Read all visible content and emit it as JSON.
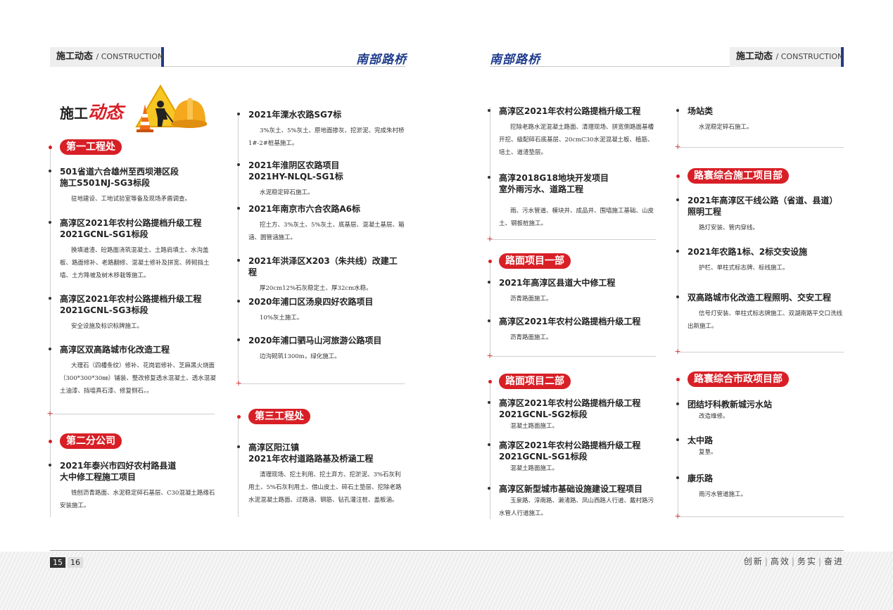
{
  "header": {
    "tab_cn": "施工动态",
    "tab_en": "/ CONSTRUCTION",
    "brand": "南部路桥"
  },
  "main_title": {
    "a": "施工",
    "b": "动态"
  },
  "left": {
    "col1": {
      "s1": {
        "badge": "第一工程处",
        "items": [
          {
            "title": "501省道六合雄州至西坝港区段\n施工S501NJ-SG3标段",
            "desc": "驻地建设、工地试验室等备及现场矛盾调查。"
          },
          {
            "title": "高淳区2021年农村公路提档升级工程\n2021GCNL-SG1标段",
            "desc": "换填道渣、砼路面浇筑混凝土、土路肩填土、水沟盖板、路面修补、老路翻修、混凝土修补及拼宽、砖砌挡土墙、土方降坡及树木移栽等施工。"
          },
          {
            "title": "高淳区2021年农村公路提档升级工程\n2021GCNL-SG3标段",
            "desc": "安全设施及标识标牌施工。"
          },
          {
            "title": "高淳区双高路城市化改造工程",
            "desc": "大理石（四槽条纹）修补、花岗岩修补、芝麻黑火烧面（300*300*30㎜）铺装、整改修复透水混凝土、透水混凝土油漆、挡墙真石漆、修复侧石。。"
          }
        ]
      },
      "s2": {
        "badge": "第二分公司",
        "items": [
          {
            "title": "2021年泰兴市四好农村路县道\n大中修工程施工项目",
            "desc": "铣刨沥青路面、水泥稳定碎石基层、C30混凝土路缘石安装施工。"
          }
        ]
      }
    },
    "col2": {
      "items": [
        {
          "title": "2021年溧水农路SG7标",
          "desc": "3%灰土、5%灰土、原地面掺灰、挖淤泥、完成朱村桥1#-2#桩基施工。"
        },
        {
          "title": "2021年淮阴区农路项目\n2021HY-NLQL-SG1标",
          "desc": "水泥稳定碎石施工。"
        },
        {
          "title": "2021年南京市六合农路A6标",
          "desc": "挖土方、3%灰土、5%灰土、底基层、混凝土基层、箱涵、圆管涵施工。"
        },
        {
          "title": "2021年洪泽区X203（朱共线）改建工程",
          "desc": "厚20cm12%石灰稳定土、厚32cm水稳。"
        },
        {
          "title": "2020年浦口区汤泉四好农路项目",
          "desc": "10%灰土施工。"
        },
        {
          "title": "2020年浦口驷马山河旅游公路项目",
          "desc": "边沟砌筑1300m，绿化施工。"
        }
      ],
      "s3": {
        "badge": "第三工程处",
        "items": [
          {
            "title": "高淳区阳江镇\n2021年农村道路路基及桥涵工程",
            "desc": "清理现场、挖土利用、挖土弃方、挖淤泥、3%石灰利用土、5%石灰利用土、借山皮土、碎石土垫层、挖除老路水泥混凝土路面、过路涵、钢筋、钻孔灌注桩、盖板涵。"
          }
        ]
      }
    }
  },
  "right": {
    "col1": {
      "items": [
        {
          "title": "高淳区2021年农村公路提档升级工程",
          "desc": "挖除老路水泥混凝土路面、清理现场、拼宽侧路面基槽开挖、级配碎石底基层、20cmC30水泥混凝土板、植筋、培土、道渣垫层。"
        },
        {
          "title": "高淳2018G18地块开发项目\n室外雨污水、道路工程",
          "desc": "雨、污水管道、模块井、成品井、围墙施工基础、山皮土、钢板桩施工。"
        }
      ],
      "s1": {
        "badge": "路面项目一部",
        "items": [
          {
            "title": "2021年高淳区县道大中修工程",
            "desc": "沥青路面施工。"
          },
          {
            "title": "高淳区2021年农村公路提档升级工程",
            "desc": "沥青路面施工。"
          }
        ]
      },
      "s2": {
        "badge": "路面项目二部",
        "items": [
          {
            "title": "高淳区2021年农村公路提档升级工程\n2021GCNL-SG2标段",
            "desc": "混凝土路面施工。"
          },
          {
            "title": "高淳区2021年农村公路提档升级工程\n2021GCNL-SG1标段",
            "desc": "混凝土路面施工。"
          },
          {
            "title": "高淳区新型城市基础设施建设工程项目",
            "desc": "玉泉路、淳南路、濑渚路、凤山西路人行道、戴村路污水管人行道施工。"
          }
        ]
      }
    },
    "col2": {
      "items": [
        {
          "title": "场站类",
          "desc": "水泥稳定碎石施工。"
        }
      ],
      "s1": {
        "badge": "路寰综合施工项目部",
        "items": [
          {
            "title": "2021年高淳区干线公路（省道、县道）\n照明工程",
            "desc": "路灯安装、管内穿线。"
          },
          {
            "title": "2021年农路1标、2标交安设施",
            "desc": "护栏、单柱式标志牌、标线施工。"
          },
          {
            "title": "双高路城市化改造工程照明、交安工程",
            "desc": "信号灯安装、单柱式标志牌施工、双湖南路平交口洗线出新施工。"
          }
        ]
      },
      "s2": {
        "badge": "路寰综合市政项目部",
        "items": [
          {
            "title": "团结圩科教新城污水站",
            "desc": "改造维修。"
          },
          {
            "title": "太中路",
            "desc": "复垦。"
          },
          {
            "title": "康乐路",
            "desc": "雨污水管道施工。"
          }
        ]
      }
    }
  },
  "footer": {
    "page_left": "15",
    "page_right": "16",
    "slogan": [
      "创新",
      "高效",
      "务实",
      "奋进"
    ]
  },
  "icons": [
    "traffic-cone-icon",
    "worker-icon",
    "hard-hat-icon"
  ],
  "colors": {
    "accent_red": "#d81f26",
    "brand_blue": "#1f3c8c"
  }
}
